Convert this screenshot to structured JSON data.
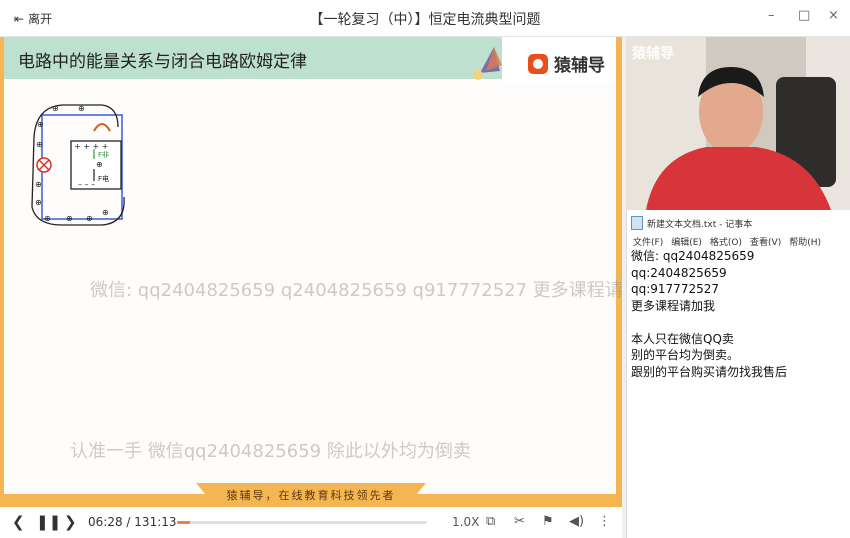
{
  "titlebar": {
    "leave_label": "离开",
    "title": "【一轮复习（中）】恒定电流典型问题",
    "minimize": "–",
    "maximize": "□",
    "close": "×"
  },
  "slide": {
    "heading": "电路中的能量关系与闭合电路欧姆定律",
    "brand": "猿辅导",
    "watermark_top": "微信: qq2404825659 q2404825659 q917772527 更多课程请",
    "watermark_bottom": "认准一手  微信qq2404825659 除此以外均为倒卖",
    "footer": "猿辅导，在线教育科技领先者",
    "labels": {
      "f_upper": "F非",
      "f_lower": "F电"
    }
  },
  "controls": {
    "current_time": "06:28",
    "separator": "/",
    "total_time": "131:13",
    "progress": 0.05,
    "speed": "1.0X"
  },
  "camera": {
    "logo": "猿辅导"
  },
  "notepad": {
    "title": "新建文本文档.txt - 记事本",
    "menu": [
      "文件(F)",
      "编辑(E)",
      "格式(O)",
      "查看(V)",
      "帮助(H)"
    ],
    "lines": [
      "微信: qq2404825659",
      "qq:2404825659",
      "qq:917772527",
      "更多课程请加我",
      "",
      "本人只在微信QQ卖",
      "别的平台均为倒卖。",
      "跟别的平台购买请勿找我售后"
    ]
  },
  "colors": {
    "accent": "#f4b552",
    "header_green": "#bde0cf",
    "progress": "#f0803c"
  }
}
